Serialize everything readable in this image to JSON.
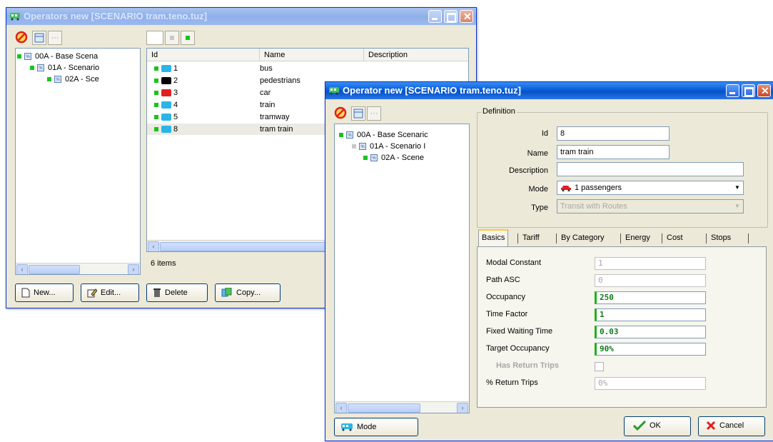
{
  "back_window": {
    "title": "Operators  new [SCENARIO tram.teno.tuz]",
    "tree": [
      {
        "label": "00A  - Base Scena"
      },
      {
        "label": "01A  - Scenario"
      },
      {
        "label": "02A  - Sce"
      }
    ],
    "list": {
      "columns": [
        "Id",
        "Name",
        "Description"
      ],
      "rows": [
        {
          "id": "1",
          "name": "bus",
          "mode_icon": "bus-icon",
          "color": "#2ab5e8"
        },
        {
          "id": "2",
          "name": "pedestrians",
          "mode_icon": "pedestrian-icon",
          "color": "#000000"
        },
        {
          "id": "3",
          "name": "car",
          "mode_icon": "car-icon",
          "color": "#e02020"
        },
        {
          "id": "4",
          "name": "train",
          "mode_icon": "train-icon",
          "color": "#2ab5e8"
        },
        {
          "id": "5",
          "name": "tramway",
          "mode_icon": "tram-icon",
          "color": "#2ab5e8"
        },
        {
          "id": "8",
          "name": "tram train",
          "mode_icon": "tram-train-icon",
          "color": "#2ab5e8"
        }
      ]
    },
    "status": "6 items",
    "buttons": {
      "new": "New...",
      "edit": "Edit...",
      "delete": "Delete",
      "copy": "Copy..."
    }
  },
  "front_window": {
    "title": "Operator  new [SCENARIO tram.teno.tuz]",
    "tree": [
      {
        "label": "00A  - Base Scenaric"
      },
      {
        "label": "01A  - Scenario I"
      },
      {
        "label": "02A  - Scene"
      }
    ],
    "definition": {
      "group_label": "Definition",
      "id_label": "Id",
      "id_value": "8",
      "name_label": "Name",
      "name_value": "tram train",
      "description_label": "Description",
      "description_value": "",
      "mode_label": "Mode",
      "mode_value": "1 passengers",
      "type_label": "Type",
      "type_value": "Transit with Routes"
    },
    "tabs": [
      "Basics",
      "Tariff",
      "By Category",
      "Energy",
      "Cost",
      "Stops"
    ],
    "active_tab": "Basics",
    "params": [
      {
        "label": "Modal Constant",
        "value": "1",
        "style": "grey"
      },
      {
        "label": "Path ASC",
        "value": "0",
        "style": "grey"
      },
      {
        "label": "Occupancy",
        "value": "250",
        "style": "green"
      },
      {
        "label": "Time Factor",
        "value": "1",
        "style": "green"
      },
      {
        "label": "Fixed Waiting Time",
        "value": "0.03",
        "style": "green"
      },
      {
        "label": "Target Occupancy",
        "value": "90%",
        "style": "green"
      },
      {
        "label": "Has Return Trips",
        "value": "",
        "style": "checkbox"
      },
      {
        "label": "% Return Trips",
        "value": "0%",
        "style": "grey"
      }
    ],
    "buttons": {
      "mode": "Mode",
      "ok": "OK",
      "cancel": "Cancel"
    }
  }
}
